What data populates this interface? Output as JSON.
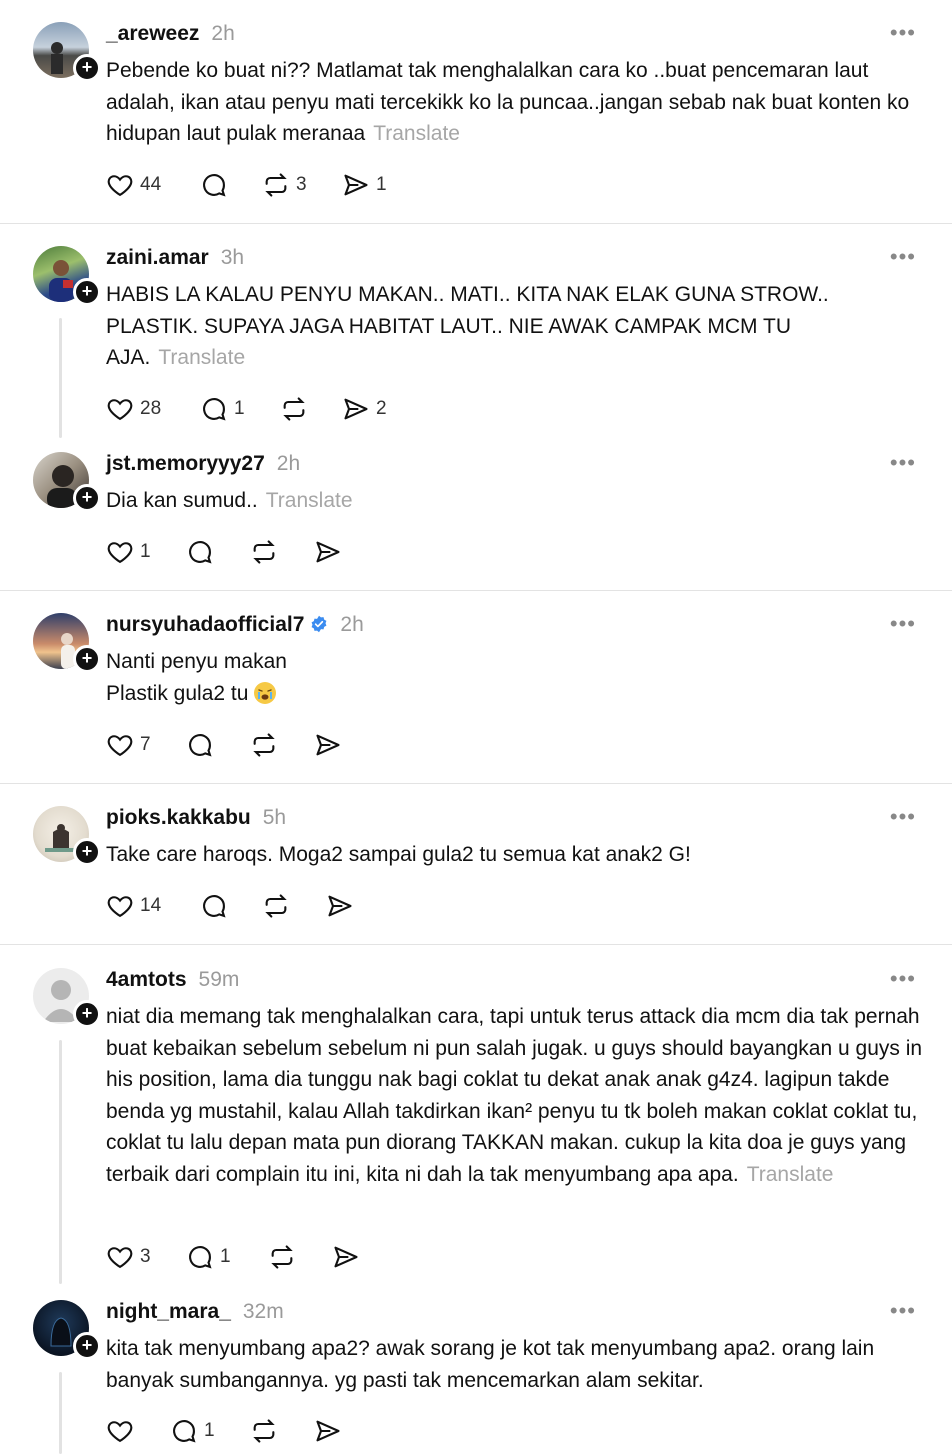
{
  "translate_label": "Translate",
  "comments": [
    {
      "username": "_areweez",
      "time": "2h",
      "text": "Pebende ko buat ni?? Matlamat tak menghalalkan cara ko ..buat pencemaran laut adalah, ikan atau penyu mati tercekikk ko la puncaa..jangan sebab nak buat konten ko hidupan laut pulak meranaa",
      "likes": "44",
      "replies": "",
      "reposts": "3",
      "shares": "1"
    },
    {
      "username": "zaini.amar",
      "time": "3h",
      "text": "HABIS LA KALAU PENYU MAKAN.. MATI.. KITA NAK ELAK GUNA STROW.. PLASTIK. SUPAYA JAGA HABITAT LAUT.. NIE AWAK CAMPAK MCM TU AJA.",
      "likes": "28",
      "replies": "1",
      "reposts": "",
      "shares": "2"
    },
    {
      "username": "jst.memoryyy27",
      "time": "2h",
      "text": "Dia kan sumud..",
      "likes": "1",
      "replies": "",
      "reposts": "",
      "shares": ""
    },
    {
      "username": "nursyuhadaofficial7",
      "time": "2h",
      "text_line1": "Nanti penyu makan",
      "text_line2": "Plastik gula2 tu",
      "likes": "7",
      "replies": "",
      "reposts": "",
      "shares": ""
    },
    {
      "username": "pioks.kakkabu",
      "time": "5h",
      "text": "Take care haroqs. Moga2 sampai gula2 tu semua kat anak2 G!",
      "likes": "14",
      "replies": "",
      "reposts": "",
      "shares": ""
    },
    {
      "username": "4amtots",
      "time": "59m",
      "text": "niat dia memang tak menghalalkan cara, tapi untuk terus attack dia mcm dia tak pernah buat kebaikan sebelum sebelum ni pun salah jugak. u guys should bayangkan u guys in his position, lama dia tunggu nak bagi coklat tu dekat anak anak g4z4. lagipun takde benda yg mustahil, kalau Allah takdirkan ikan² penyu tu tk boleh makan coklat coklat tu, coklat tu lalu depan mata pun diorang TAKKAN makan. cukup la kita doa je guys yang terbaik dari complain itu ini, kita ni dah la tak menyumbang apa apa.",
      "likes": "3",
      "replies": "1",
      "reposts": "",
      "shares": ""
    },
    {
      "username": "night_mara_",
      "time": "32m",
      "text": "kita tak menyumbang apa2? awak sorang je kot tak menyumbang apa2. orang lain banyak sumbangannya. yg pasti tak mencemarkan alam sekitar.",
      "likes": "",
      "replies": "1",
      "reposts": "",
      "shares": ""
    }
  ],
  "more_icon": "•••"
}
